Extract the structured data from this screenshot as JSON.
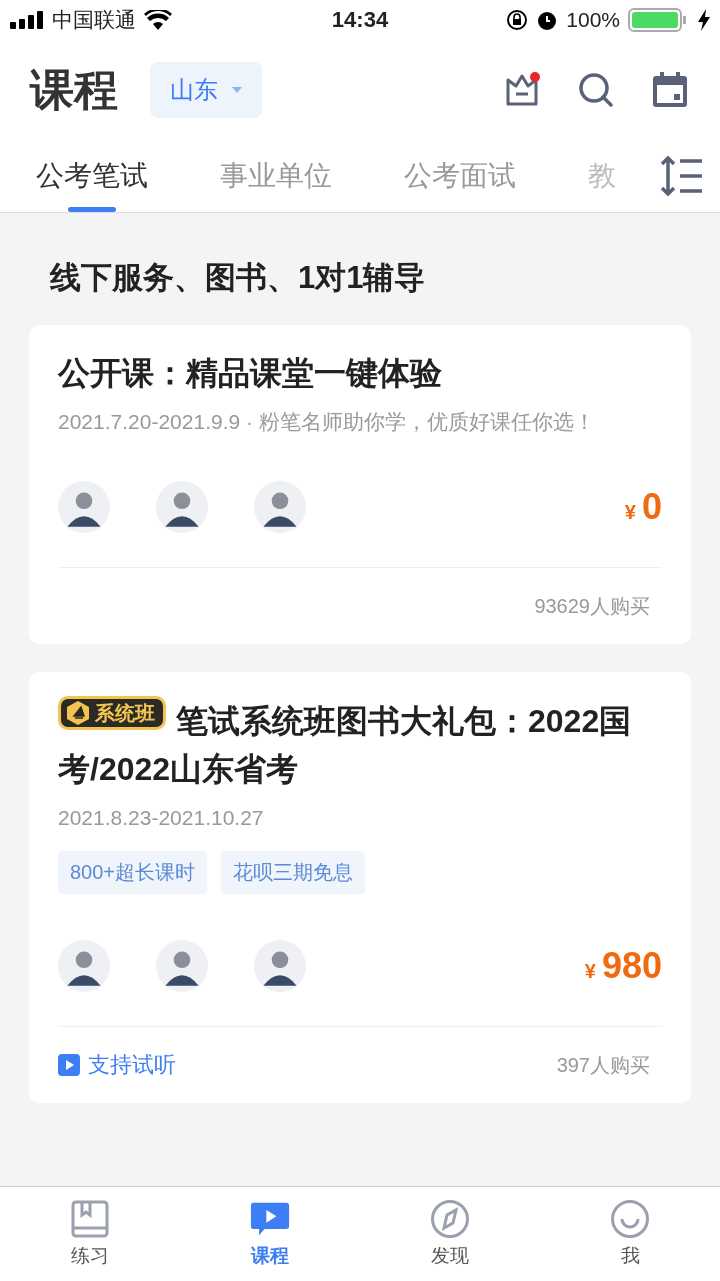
{
  "status_bar": {
    "carrier": "中国联通",
    "time": "14:34",
    "battery": "100%"
  },
  "header": {
    "title": "课程",
    "region": "山东"
  },
  "tabs": [
    {
      "label": "公考笔试",
      "selected": true
    },
    {
      "label": "事业单位",
      "selected": false
    },
    {
      "label": "公考面试",
      "selected": false
    },
    {
      "label": "教",
      "selected": false
    }
  ],
  "section_title": "线下服务、图书、1对1辅导",
  "courses": [
    {
      "title": "公开课：精品课堂一键体验",
      "subtitle": "2021.7.20-2021.9.9 · 粉笔名师助你学，优质好课任你选！",
      "currency": "¥",
      "price": "0",
      "buyers": "93629人购买"
    },
    {
      "badge": "系统班",
      "title": "笔试系统班图书大礼包：2022国考/2022山东省考",
      "subtitle": "2021.8.23-2021.10.27",
      "tags": [
        "800+超长课时",
        "花呗三期免息"
      ],
      "currency": "¥",
      "price": "980",
      "trial": "支持试听",
      "buyers": "397人购买"
    }
  ],
  "nav": [
    {
      "label": "练习",
      "kind": "book",
      "selected": false
    },
    {
      "label": "课程",
      "kind": "play",
      "selected": true
    },
    {
      "label": "发现",
      "kind": "compass",
      "selected": false
    },
    {
      "label": "我",
      "kind": "smile",
      "selected": false
    }
  ]
}
